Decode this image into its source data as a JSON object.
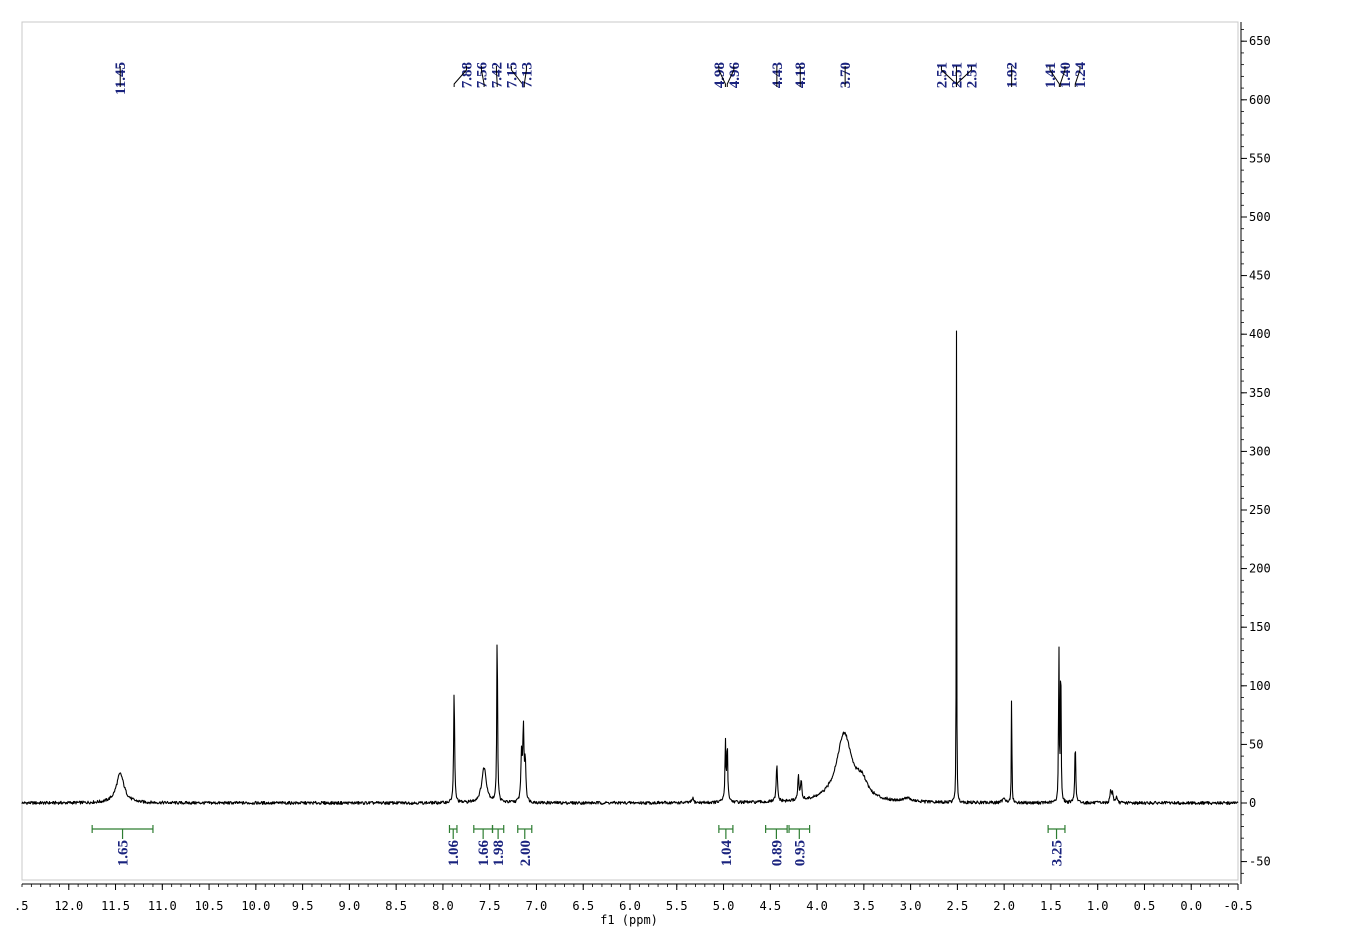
{
  "chart_data": {
    "type": "line",
    "xlabel": "f1 (ppm)",
    "xlim": [
      12.5,
      -0.5
    ],
    "xlim_reversed": true,
    "ylim": [
      -65,
      660
    ],
    "x_ticks": [
      12.0,
      11.5,
      11.0,
      10.5,
      10.0,
      9.5,
      9.0,
      8.5,
      8.0,
      7.5,
      7.0,
      6.5,
      6.0,
      5.5,
      5.0,
      4.5,
      4.0,
      3.5,
      3.0,
      2.5,
      2.0,
      1.5,
      1.0,
      0.5,
      0.0,
      -0.5
    ],
    "x_tick_labels": [
      ".5",
      "12.0",
      "11.5",
      "11.0",
      "10.5",
      "10.0",
      "9.5",
      "9.0",
      "8.5",
      "8.0",
      "7.5",
      "7.0",
      "6.5",
      "6.0",
      "5.5",
      "5.0",
      "4.5",
      "4.0",
      "3.5",
      "3.0",
      "2.5",
      "2.0",
      "1.5",
      "1.0",
      "0.5",
      "0.0",
      "-0.5"
    ],
    "y_ticks": [
      -50,
      0,
      50,
      100,
      150,
      200,
      250,
      300,
      350,
      400,
      450,
      500,
      550,
      600,
      650
    ],
    "y_tick_labels": [
      "-50",
      "0",
      "50",
      "100",
      "150",
      "200",
      "250",
      "300",
      "350",
      "400",
      "450",
      "500",
      "550",
      "600",
      "650"
    ],
    "peak_groups": [
      {
        "labels": [
          "11.45"
        ],
        "shifts": [
          11.45
        ]
      },
      {
        "labels": [
          "7.88",
          "7.56",
          "7.42",
          "7.15",
          "7.13"
        ],
        "shifts": [
          7.88,
          7.56,
          7.42,
          7.15,
          7.13
        ]
      },
      {
        "labels": [
          "4.98",
          "4.96"
        ],
        "shifts": [
          4.98,
          4.96
        ]
      },
      {
        "labels": [
          "4.43"
        ],
        "shifts": [
          4.43
        ]
      },
      {
        "labels": [
          "4.18"
        ],
        "shifts": [
          4.18
        ]
      },
      {
        "labels": [
          "3.70"
        ],
        "shifts": [
          3.7
        ]
      },
      {
        "labels": [
          "2.51",
          "2.51",
          "2.51"
        ],
        "shifts": [
          2.51,
          2.51,
          2.51
        ]
      },
      {
        "labels": [
          "1.92"
        ],
        "shifts": [
          1.92
        ]
      },
      {
        "labels": [
          "1.41",
          "1.40",
          "1.24"
        ],
        "shifts": [
          1.41,
          1.4,
          1.24
        ]
      }
    ],
    "integrals": [
      {
        "from": 11.75,
        "to": 11.1,
        "value": "1.65"
      },
      {
        "from": 7.93,
        "to": 7.85,
        "value": "1.06"
      },
      {
        "from": 7.67,
        "to": 7.47,
        "value": "1.66"
      },
      {
        "from": 7.47,
        "to": 7.35,
        "value": "1.98"
      },
      {
        "from": 7.2,
        "to": 7.05,
        "value": "2.00"
      },
      {
        "from": 5.05,
        "to": 4.9,
        "value": "1.04"
      },
      {
        "from": 4.55,
        "to": 4.32,
        "value": "0.89"
      },
      {
        "from": 4.3,
        "to": 4.08,
        "value": "0.95"
      },
      {
        "from": 1.53,
        "to": 1.35,
        "value": "3.25"
      }
    ],
    "signals": [
      {
        "shift": 11.45,
        "height": 25,
        "width": 0.05,
        "shape": "broad"
      },
      {
        "shift": 7.88,
        "height": 97,
        "width": 0.006,
        "shape": "sharp"
      },
      {
        "shift": 7.56,
        "height": 30,
        "width": 0.03,
        "shape": "broad"
      },
      {
        "shift": 7.42,
        "height": 153,
        "width": 0.005,
        "shape": "sharp"
      },
      {
        "shift": 7.16,
        "height": 40,
        "width": 0.008,
        "shape": "sharp"
      },
      {
        "shift": 7.14,
        "height": 62,
        "width": 0.007,
        "shape": "sharp"
      },
      {
        "shift": 7.12,
        "height": 35,
        "width": 0.008,
        "shape": "sharp"
      },
      {
        "shift": 5.33,
        "height": 4,
        "width": 0.01,
        "shape": "sharp"
      },
      {
        "shift": 4.98,
        "height": 46,
        "width": 0.005,
        "shape": "sharp"
      },
      {
        "shift": 4.96,
        "height": 46,
        "width": 0.005,
        "shape": "sharp"
      },
      {
        "shift": 4.97,
        "height": 8,
        "width": 0.02,
        "shape": "broad"
      },
      {
        "shift": 4.43,
        "height": 31,
        "width": 0.008,
        "shape": "sharp"
      },
      {
        "shift": 4.2,
        "height": 20,
        "width": 0.008,
        "shape": "sharp"
      },
      {
        "shift": 4.17,
        "height": 16,
        "width": 0.008,
        "shape": "sharp"
      },
      {
        "shift": 3.71,
        "height": 58,
        "width": 0.1,
        "shape": "broad"
      },
      {
        "shift": 3.52,
        "height": 14,
        "width": 0.07,
        "shape": "broad"
      },
      {
        "shift": 3.04,
        "height": 3,
        "width": 0.05,
        "shape": "broad"
      },
      {
        "shift": 2.51,
        "height": 420,
        "width": 0.0025,
        "shape": "sharp"
      },
      {
        "shift": 2.0,
        "height": 5,
        "width": 0.015,
        "shape": "sharp"
      },
      {
        "shift": 1.92,
        "height": 108,
        "width": 0.003,
        "shape": "sharp"
      },
      {
        "shift": 1.415,
        "height": 140,
        "width": 0.004,
        "shape": "sharp"
      },
      {
        "shift": 1.395,
        "height": 140,
        "width": 0.004,
        "shape": "sharp"
      },
      {
        "shift": 1.24,
        "height": 51,
        "width": 0.006,
        "shape": "sharp"
      },
      {
        "shift": 0.86,
        "height": 11,
        "width": 0.008,
        "shape": "sharp"
      },
      {
        "shift": 0.84,
        "height": 8,
        "width": 0.008,
        "shape": "sharp"
      },
      {
        "shift": 0.8,
        "height": 5,
        "width": 0.008,
        "shape": "sharp"
      }
    ],
    "colors": {
      "spectrum": "#000000",
      "peak_labels": "#1a237e",
      "integrals": "#2e7d32",
      "axes": "#000000"
    }
  }
}
